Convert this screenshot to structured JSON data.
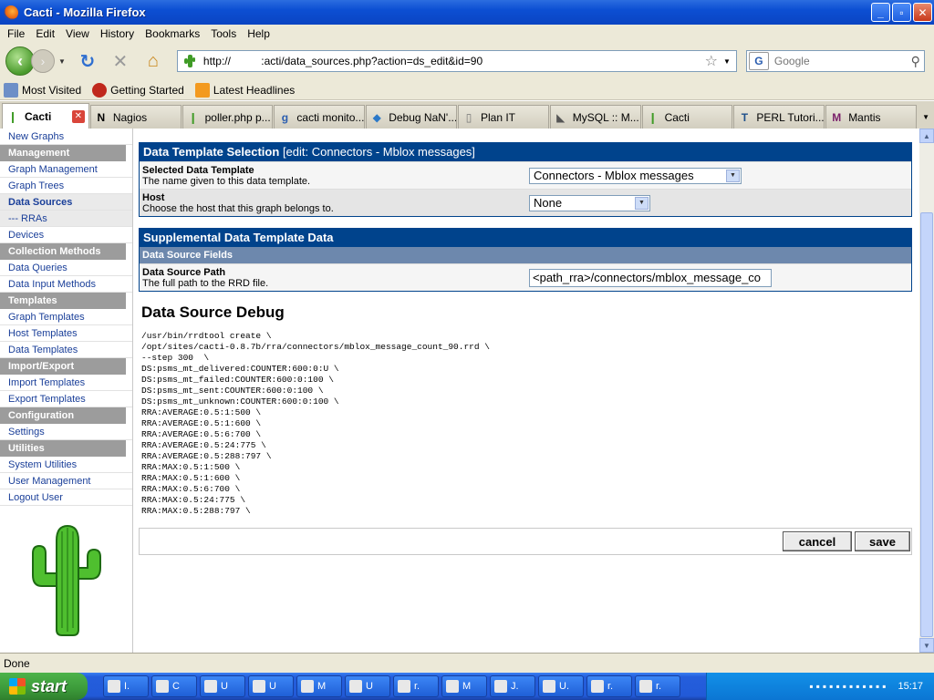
{
  "window": {
    "title": "Cacti - Mozilla Firefox"
  },
  "menu": [
    "File",
    "Edit",
    "View",
    "History",
    "Bookmarks",
    "Tools",
    "Help"
  ],
  "address": {
    "url": "http://          :acti/data_sources.php?action=ds_edit&id=90"
  },
  "search": {
    "placeholder": "Google"
  },
  "bookmarks": [
    "Most Visited",
    "Getting Started",
    "Latest Headlines"
  ],
  "tabs": [
    "Cacti",
    "Nagios",
    "poller.php p...",
    "cacti monito...",
    "Debug NaN'...",
    "Plan IT",
    "MySQL :: M...",
    "Cacti",
    "PERL Tutori...",
    "Mantis"
  ],
  "sidebar": {
    "top_link": "New Graphs",
    "management": "Management",
    "graph_management": "Graph Management",
    "graph_trees": "Graph Trees",
    "data_sources": "Data Sources",
    "rras": "--- RRAs",
    "devices": "Devices",
    "collection_methods": "Collection Methods",
    "data_queries": "Data Queries",
    "data_input_methods": "Data Input Methods",
    "templates": "Templates",
    "graph_templates": "Graph Templates",
    "host_templates": "Host Templates",
    "data_templates": "Data Templates",
    "import_export": "Import/Export",
    "import_templates": "Import Templates",
    "export_templates": "Export Templates",
    "configuration": "Configuration",
    "settings": "Settings",
    "utilities": "Utilities",
    "system_utilities": "System Utilities",
    "user_management": "User Management",
    "logout": "Logout User"
  },
  "template_panel": {
    "title": "Data Template Selection",
    "edit_label": "[edit: Connectors - Mblox messages]",
    "selected_label": "Selected Data Template",
    "selected_desc": "The name given to this data template.",
    "selected_value": "Connectors - Mblox messages",
    "host_label": "Host",
    "host_desc": "Choose the host that this graph belongs to.",
    "host_value": "None"
  },
  "supplemental_panel": {
    "title": "Supplemental Data Template Data",
    "section": "Data Source Fields",
    "path_label": "Data Source Path",
    "path_desc": "The full path to the RRD file.",
    "path_value": "<path_rra>/connectors/mblox_message_co"
  },
  "debug": {
    "title": "Data Source Debug",
    "lines": [
      "/usr/bin/rrdtool create \\",
      "/opt/sites/cacti-0.8.7b/rra/connectors/mblox_message_count_90.rrd \\",
      "--step 300  \\",
      "DS:psms_mt_delivered:COUNTER:600:0:U \\",
      "DS:psms_mt_failed:COUNTER:600:0:100 \\",
      "DS:psms_mt_sent:COUNTER:600:0:100 \\",
      "DS:psms_mt_unknown:COUNTER:600:0:100 \\",
      "RRA:AVERAGE:0.5:1:500 \\",
      "RRA:AVERAGE:0.5:1:600 \\",
      "RRA:AVERAGE:0.5:6:700 \\",
      "RRA:AVERAGE:0.5:24:775 \\",
      "RRA:AVERAGE:0.5:288:797 \\",
      "RRA:MAX:0.5:1:500 \\",
      "RRA:MAX:0.5:1:600 \\",
      "RRA:MAX:0.5:6:700 \\",
      "RRA:MAX:0.5:24:775 \\",
      "RRA:MAX:0.5:288:797 \\"
    ]
  },
  "actions": {
    "cancel": "cancel",
    "save": "save"
  },
  "status": {
    "text": "Done"
  },
  "taskbar": {
    "start": "start",
    "tasks": [
      "I.",
      "C",
      "U",
      "U",
      "M",
      "U",
      "r.",
      "M",
      "J.",
      "U.",
      "r.",
      "r."
    ],
    "clock": "15:17"
  }
}
